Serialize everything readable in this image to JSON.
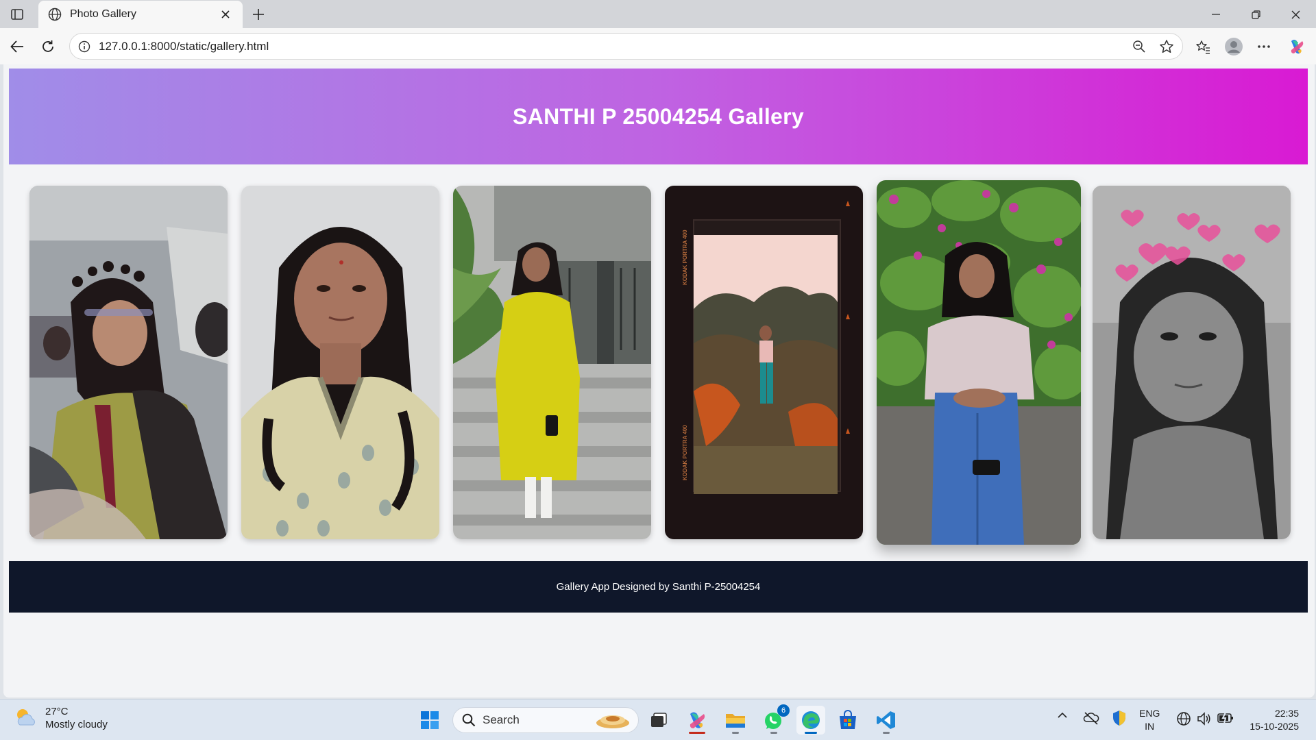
{
  "browser": {
    "tab_title": "Photo Gallery",
    "url": "127.0.0.1:8000/static/gallery.html"
  },
  "page": {
    "header_title": "SANTHI P 25004254 Gallery",
    "footer_text": "Gallery App Designed by Santhi P-25004254",
    "header_gradient": [
      "#a08de8",
      "#bf63e2",
      "#d91ad3"
    ],
    "footer_color": "#0f172a",
    "photos": [
      {
        "name": "photo-1",
        "style": "classroom-selfie",
        "hovered": false
      },
      {
        "name": "photo-2",
        "style": "portrait-plain-background",
        "hovered": false
      },
      {
        "name": "photo-3",
        "style": "yellow-dress-on-steps",
        "hovered": false
      },
      {
        "name": "photo-4",
        "style": "film-frame-kodak-portra",
        "hovered": false
      },
      {
        "name": "photo-5",
        "style": "garden-flowers",
        "hovered": true
      },
      {
        "name": "photo-6",
        "style": "grayscale-hearts-filter",
        "hovered": false
      }
    ],
    "film_strip_text": "KODAK PORTRA 400"
  },
  "taskbar": {
    "temperature": "27°C",
    "weather": "Mostly cloudy",
    "search_label": "Search",
    "whatsapp_badge": "6",
    "language_line1": "ENG",
    "language_line2": "IN",
    "time": "22:35",
    "date": "15-10-2025",
    "apps": [
      "task-view",
      "copilot",
      "file-explorer",
      "whatsapp",
      "edge",
      "microsoft-store",
      "vscode"
    ]
  }
}
